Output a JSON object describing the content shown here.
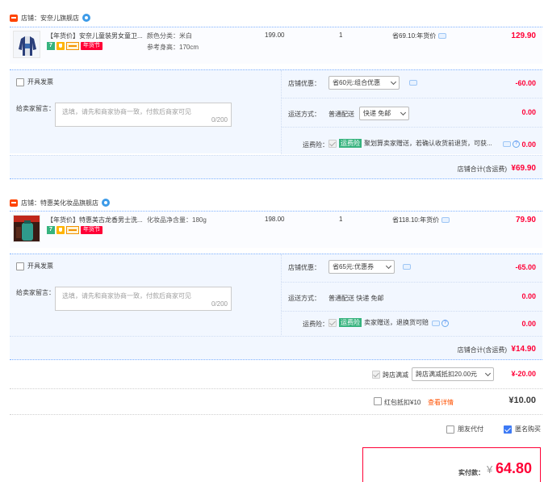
{
  "shops": [
    {
      "name": "店铺：安奈儿旗舰店",
      "item": {
        "title": "【年货价】安奈儿童装男女童卫...",
        "badge_7": "7",
        "badge_festival": "年货节",
        "sku_color": "颜色分类：米白",
        "sku_size": "参考身高：170cm",
        "unit_price": "199.00",
        "qty": "1",
        "saving": "省69.10:年货价",
        "total": "129.90"
      },
      "invoice_label": "开具发票",
      "memo_label": "给卖家留言：",
      "memo_placeholder": "选填，请先和商家协商一致，付款后商家可见",
      "memo_count": "0/200",
      "discount_label": "店铺优惠：",
      "discount_select": "省60元:组合优惠",
      "discount_value": "-60.00",
      "ship_label": "运送方式：",
      "ship_type": "普通配送",
      "ship_select": "快递 免邮",
      "ship_value": "0.00",
      "ins_label": "运费险：",
      "ins_tag": "运费险",
      "ins_text": "聚划算卖家赠送，若确认收货前退货，可获...",
      "ins_value": "0.00",
      "total_label": "店铺合计(含运费)",
      "total_value": "¥69.90"
    },
    {
      "name": "店铺：特惠美化妆品旗舰店",
      "item": {
        "title": "【年货价】特惠美古龙香男士洗...",
        "badge_7": "7",
        "badge_festival": "年货节",
        "sku_color": "化妆品净含量：180g",
        "sku_size": "",
        "unit_price": "198.00",
        "qty": "1",
        "saving": "省118.10:年货价",
        "total": "79.90"
      },
      "invoice_label": "开具发票",
      "memo_label": "给卖家留言：",
      "memo_placeholder": "选填，请先和商家协商一致，付款后商家可见",
      "memo_count": "0/200",
      "discount_label": "店铺优惠：",
      "discount_select": "省65元:优惠券",
      "discount_value": "-65.00",
      "ship_label": "运送方式：",
      "ship_type": "普通配送 快递 免邮",
      "ship_select": "",
      "ship_value": "0.00",
      "ins_label": "运费险：",
      "ins_tag": "运费险",
      "ins_text": "卖家赠送，退换货可赔",
      "ins_value": "0.00",
      "total_label": "店铺合计(含运费)",
      "total_value": "¥14.90"
    }
  ],
  "cross_shop": {
    "label": "跨店满减",
    "select": "跨店满减抵扣20.00元",
    "value": "¥-20.00"
  },
  "red_packet": {
    "label": "红包抵扣¥10",
    "link": "查看详情",
    "value": "¥10.00"
  },
  "friend_pay": "朋友代付",
  "anonymous": "匿名购买",
  "pay": {
    "label": "实付款：",
    "currency": "¥",
    "amount": "64.80"
  },
  "colors": {
    "accent_red": "#ff0036",
    "block_bg": "#f2f7ff",
    "divider_blue": "#80b2ff"
  }
}
